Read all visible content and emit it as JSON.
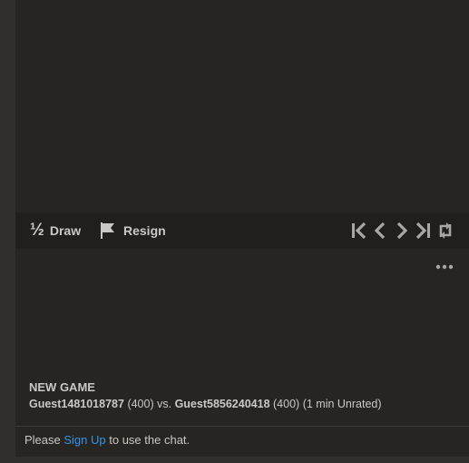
{
  "controls": {
    "draw_glyph": "½",
    "draw_label": "Draw",
    "resign_label": "Resign",
    "icons": {
      "flag": "flag-icon",
      "first": "skip-to-start-icon",
      "previous": "chevron-left-icon",
      "next": "chevron-right-icon",
      "last": "skip-to-end-icon",
      "flip": "flip-board-icon"
    }
  },
  "chat": {
    "more_icon": "more-dots-icon",
    "game_title": "NEW GAME",
    "white_player": "Guest1481018787",
    "white_rating": "(400)",
    "vs_text": "vs.",
    "black_player": "Guest5856240418",
    "black_rating": "(400)",
    "game_info": "(1 min Unrated)",
    "footer_prefix": "Please",
    "footer_link": "Sign Up",
    "footer_suffix": "to use the chat."
  },
  "colors": {
    "background": "#312e2b",
    "panel": "#262522",
    "controls_bar": "#211f1c",
    "text": "#c9c8c6",
    "link": "#3692e7"
  }
}
